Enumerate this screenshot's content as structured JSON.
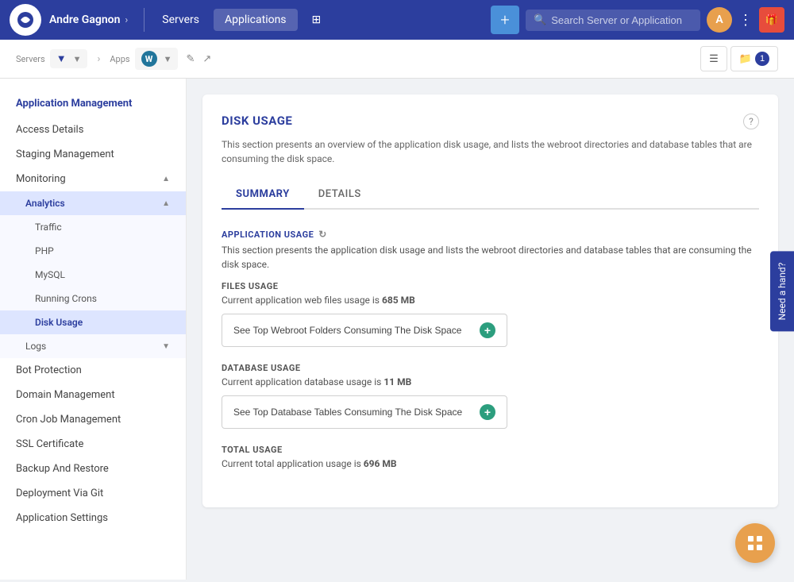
{
  "topnav": {
    "user": "Andre Gagnon",
    "servers_label": "Servers",
    "applications_label": "Applications",
    "search_placeholder": "Search Server or Application"
  },
  "breadcrumb": {
    "servers_label": "Servers",
    "server_name": "",
    "apps_label": "Apps",
    "app_name": "",
    "files_count": "1"
  },
  "sidebar": {
    "section_title": "Application Management",
    "items": [
      {
        "id": "access-details",
        "label": "Access Details",
        "active": false
      },
      {
        "id": "staging-management",
        "label": "Staging Management",
        "active": false
      },
      {
        "id": "monitoring",
        "label": "Monitoring",
        "active": false,
        "expanded": true
      },
      {
        "id": "analytics",
        "label": "Analytics",
        "active": true,
        "expanded": true
      },
      {
        "id": "traffic",
        "label": "Traffic",
        "active": false,
        "sub": true
      },
      {
        "id": "php",
        "label": "PHP",
        "active": false,
        "sub": true
      },
      {
        "id": "mysql",
        "label": "MySQL",
        "active": false,
        "sub": true
      },
      {
        "id": "running-crons",
        "label": "Running Crons",
        "active": false,
        "sub": true
      },
      {
        "id": "disk-usage",
        "label": "Disk Usage",
        "active": true,
        "sub": true
      },
      {
        "id": "logs",
        "label": "Logs",
        "active": false,
        "sub": true
      },
      {
        "id": "bot-protection",
        "label": "Bot Protection",
        "active": false
      },
      {
        "id": "domain-management",
        "label": "Domain Management",
        "active": false
      },
      {
        "id": "cron-job-management",
        "label": "Cron Job Management",
        "active": false
      },
      {
        "id": "ssl-certificate",
        "label": "SSL Certificate",
        "active": false
      },
      {
        "id": "backup-and-restore",
        "label": "Backup And Restore",
        "active": false
      },
      {
        "id": "deployment-via-git",
        "label": "Deployment Via Git",
        "active": false
      },
      {
        "id": "application-settings",
        "label": "Application Settings",
        "active": false
      }
    ]
  },
  "content": {
    "title": "DISK USAGE",
    "description": "This section presents an overview of the application disk usage, and lists the webroot directories and database tables that are consuming the disk space.",
    "tabs": [
      {
        "id": "summary",
        "label": "SUMMARY",
        "active": true
      },
      {
        "id": "details",
        "label": "DETAILS",
        "active": false
      }
    ],
    "app_usage": {
      "title": "APPLICATION USAGE",
      "description": "This section presents the application disk usage and lists the webroot directories and database tables that are consuming the disk space."
    },
    "files_usage": {
      "title": "FILES USAGE",
      "description_prefix": "Current application web files usage is ",
      "value": "685 MB",
      "btn_label": "See Top Webroot Folders Consuming The Disk Space"
    },
    "database_usage": {
      "title": "DATABASE USAGE",
      "description_prefix": "Current application database usage is ",
      "value": "11 MB",
      "btn_label": "See Top Database Tables Consuming The Disk Space"
    },
    "total_usage": {
      "title": "TOTAL USAGE",
      "description_prefix": "Current total application usage is ",
      "value": "696 MB"
    }
  },
  "need_hand": "Need a hand?",
  "floating_btn": "grid-icon"
}
